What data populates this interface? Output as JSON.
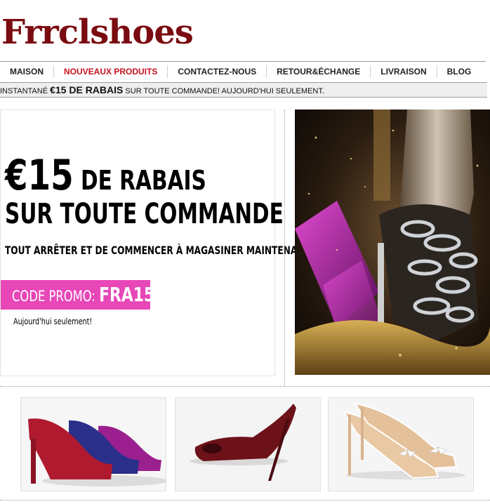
{
  "brand": {
    "logo_text": "Frrclshoes",
    "color": "#7a0b10"
  },
  "nav": {
    "items": [
      {
        "label": "MAISON",
        "active": false
      },
      {
        "label": "NOUVEAUX PRODUITS",
        "active": true
      },
      {
        "label": "CONTACTEZ-NOUS",
        "active": false
      },
      {
        "label": "RETOUR&ÉCHANGE",
        "active": false
      },
      {
        "label": "LIVRAISON",
        "active": false
      },
      {
        "label": "BLOG",
        "active": false
      }
    ],
    "active_color": "#c4121f"
  },
  "promo_bar": {
    "prefix": "INSTANTANÉ ",
    "highlight": "€15 DE RABAIS",
    "suffix": " SUR TOUTE COMMANDE! AUJOURD'HUI SEULEMENT."
  },
  "banner": {
    "amount": "€15",
    "headline_rest": " DE RABAIS",
    "headline_line2": "SUR TOUTE COMMANDE",
    "subline": "TOUT ARRÊTER ET DE COMMENCER À MAGASINER MAINTENANT",
    "code_label": "CODE PROMO: ",
    "code_value": "FRA15",
    "code_bg": "#e847b8",
    "note": "Aujourd'hui seulement!"
  },
  "hero_image": {
    "icon": "jeweled-heel-photo"
  },
  "products": [
    {
      "icon": "suede-pumps-photo",
      "colors": [
        "#b01a2e",
        "#2a2f8a",
        "#9b1f8e"
      ]
    },
    {
      "icon": "burgundy-peeptoe-photo",
      "colors": [
        "#6d1218"
      ]
    },
    {
      "icon": "nude-bow-pump-photo",
      "colors": [
        "#e9c8a4"
      ]
    }
  ]
}
